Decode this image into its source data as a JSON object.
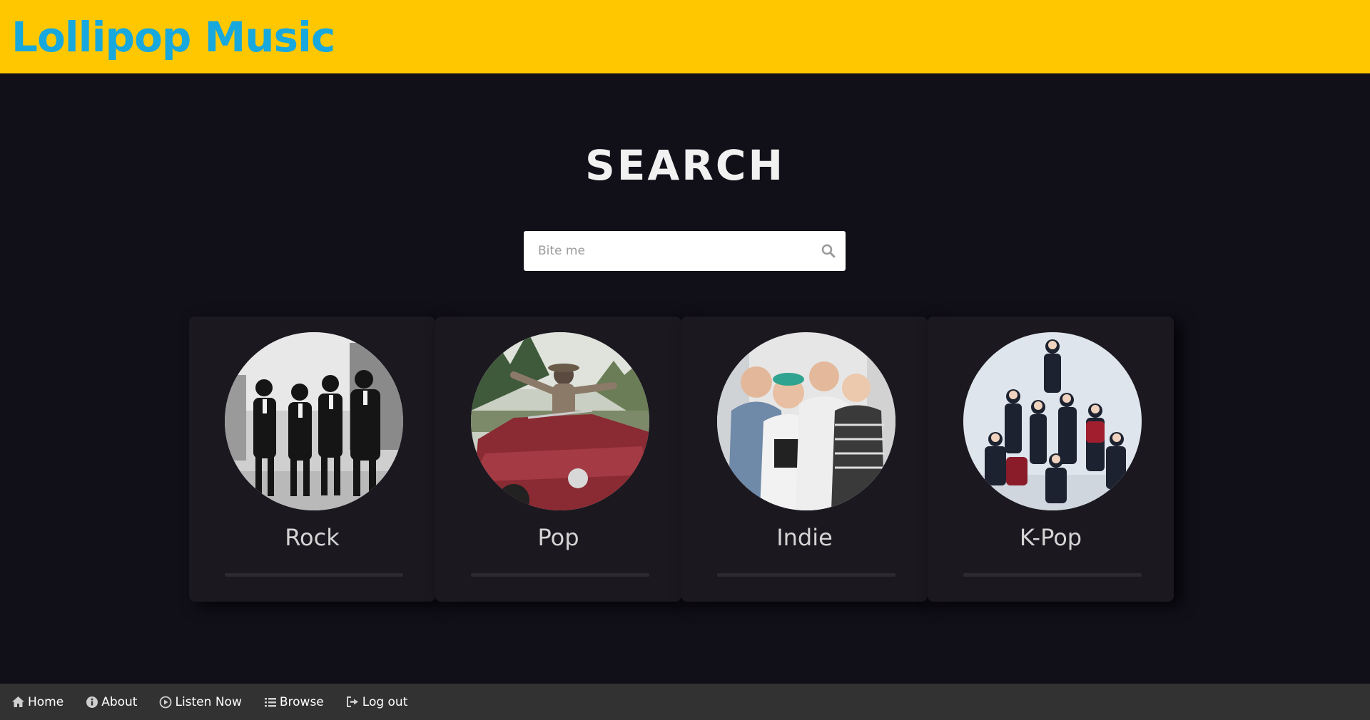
{
  "header": {
    "brand": "Lollipop Music",
    "brand_color": "#17a8de",
    "bar_color": "#ffc700"
  },
  "search": {
    "title": "SEARCH",
    "placeholder": "Bite me",
    "value": ""
  },
  "genres": [
    {
      "label": "Rock",
      "image": "band-photo-black-and-white"
    },
    {
      "label": "Pop",
      "image": "woman-in-red-convertible"
    },
    {
      "label": "Indie",
      "image": "indie-band-photo"
    },
    {
      "label": "K-Pop",
      "image": "kpop-group-photo"
    }
  ],
  "footer": {
    "items": [
      {
        "label": "Home",
        "icon": "home-icon"
      },
      {
        "label": "About",
        "icon": "info-icon"
      },
      {
        "label": "Listen Now",
        "icon": "play-circle-icon"
      },
      {
        "label": "Browse",
        "icon": "list-icon"
      },
      {
        "label": "Log out",
        "icon": "sign-out-icon"
      }
    ]
  }
}
